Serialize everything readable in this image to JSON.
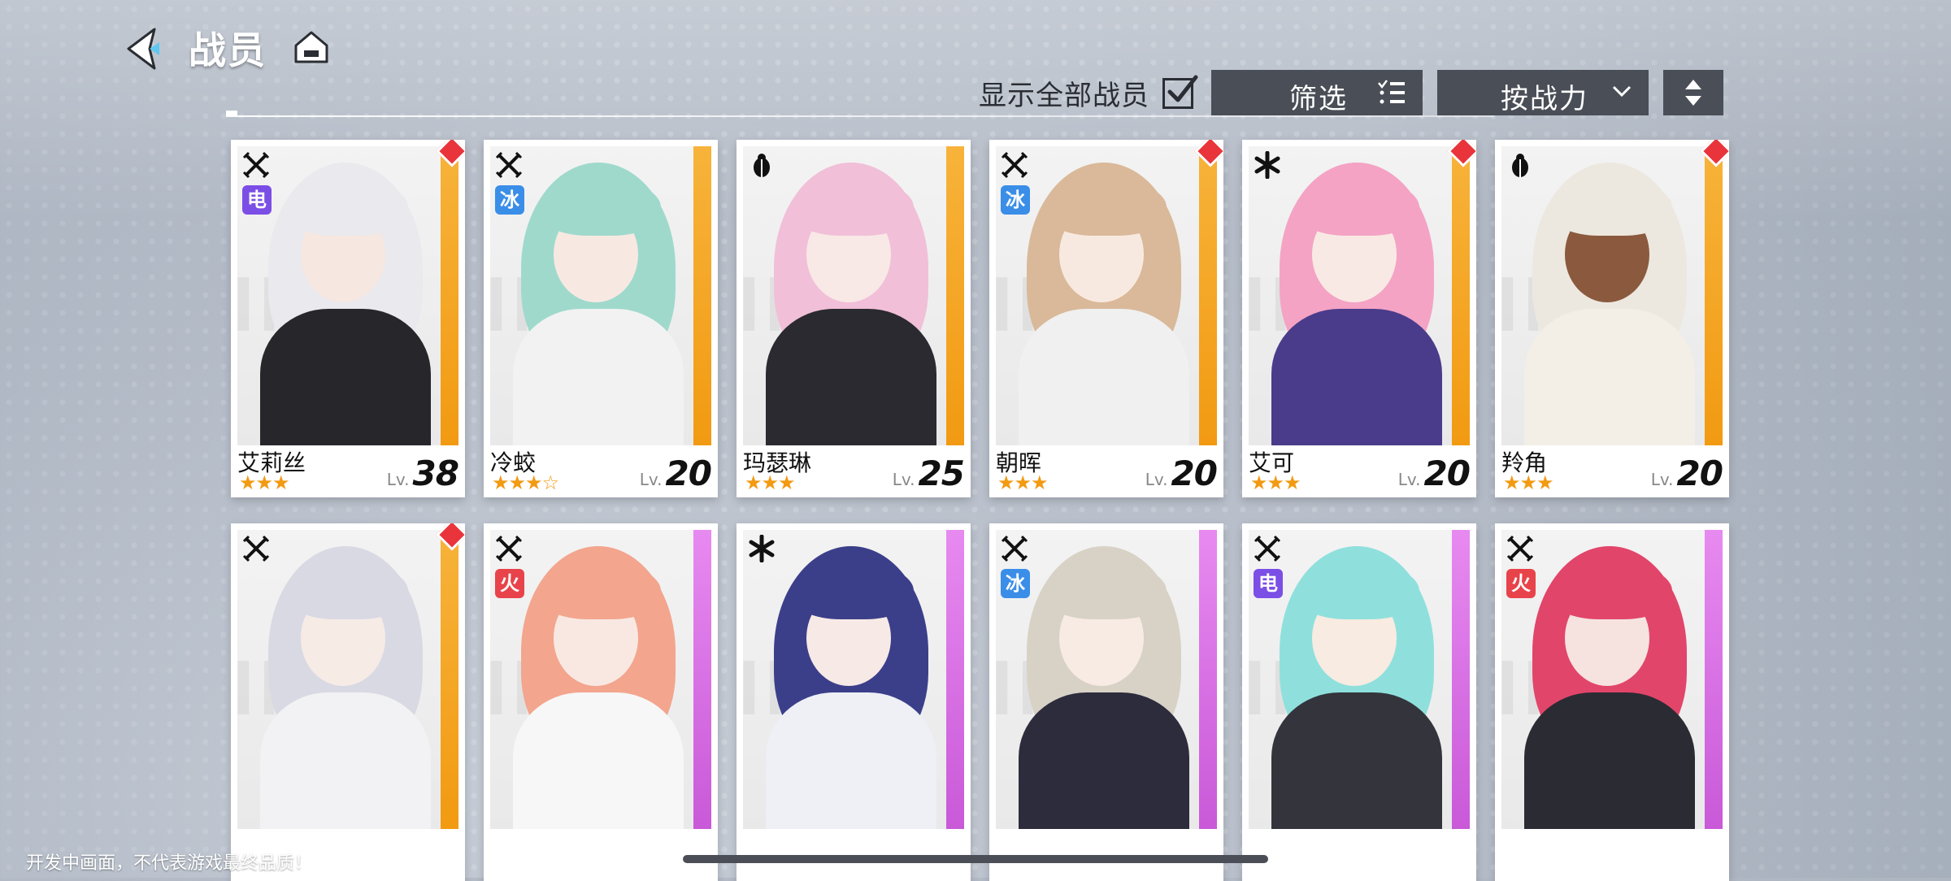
{
  "header": {
    "title": "战员",
    "back_icon": "back-arrow-icon",
    "home_icon": "home-icon"
  },
  "controls": {
    "show_all_label": "显示全部战员",
    "show_all_checked": true,
    "filter_label": "筛选",
    "sort_label": "按战力",
    "order_icon": "sort-order-icon"
  },
  "cards": [
    {
      "name": "艾莉丝",
      "stars": "★★★",
      "lv_prefix": "Lv.",
      "level": "38",
      "element": "电",
      "element_color": "#7b4ee6",
      "class_icon": "crossed-swords-icon",
      "strip": "orange",
      "new_badge": true,
      "palette": {
        "hair": "#e9e9ee",
        "face": "#f6e7e0",
        "body": "#26262b"
      }
    },
    {
      "name": "冷蛟",
      "stars": "★★★☆",
      "lv_prefix": "Lv.",
      "level": "20",
      "element": "冰",
      "element_color": "#3a8ee8",
      "class_icon": "crossed-swords-icon",
      "strip": "orange",
      "new_badge": false,
      "palette": {
        "hair": "#9fd9cc",
        "face": "#f7e9e2",
        "body": "#f2f2f2"
      }
    },
    {
      "name": "玛瑟琳",
      "stars": "★★★",
      "lv_prefix": "Lv.",
      "level": "25",
      "element": "",
      "element_color": "",
      "class_icon": "beetle-icon",
      "strip": "orange",
      "new_badge": false,
      "palette": {
        "hair": "#f1bfd8",
        "face": "#f8e8e6",
        "body": "#2a2a30"
      }
    },
    {
      "name": "朝晖",
      "stars": "★★★",
      "lv_prefix": "Lv.",
      "level": "20",
      "element": "冰",
      "element_color": "#3a8ee8",
      "class_icon": "crossed-swords-icon",
      "strip": "orange",
      "new_badge": true,
      "palette": {
        "hair": "#d9b99a",
        "face": "#f8e9e0",
        "body": "#f0f0f0"
      }
    },
    {
      "name": "艾可",
      "stars": "★★★",
      "lv_prefix": "Lv.",
      "level": "20",
      "element": "",
      "element_color": "",
      "class_icon": "asterisk-icon",
      "strip": "orange",
      "new_badge": true,
      "palette": {
        "hair": "#f4a3c4",
        "face": "#f9e9e4",
        "body": "#4a3c8a"
      }
    },
    {
      "name": "羚角",
      "stars": "★★★",
      "lv_prefix": "Lv.",
      "level": "20",
      "element": "",
      "element_color": "",
      "class_icon": "beetle-icon",
      "strip": "orange",
      "new_badge": true,
      "palette": {
        "hair": "#ece8e0",
        "face": "#8b5a3e",
        "body": "#f3efe6"
      }
    },
    {
      "name": "",
      "stars": "",
      "lv_prefix": "",
      "level": "",
      "element": "",
      "element_color": "",
      "class_icon": "crossed-swords-icon",
      "strip": "orange",
      "new_badge": true,
      "palette": {
        "hair": "#d9d9e4",
        "face": "#f7ebe6",
        "body": "#f2f2f4"
      }
    },
    {
      "name": "",
      "stars": "",
      "lv_prefix": "",
      "level": "",
      "element": "火",
      "element_color": "#e8434a",
      "class_icon": "crossed-swords-icon",
      "strip": "purple",
      "new_badge": false,
      "palette": {
        "hair": "#f3a58e",
        "face": "#f9e8e2",
        "body": "#f7f7f7"
      }
    },
    {
      "name": "",
      "stars": "",
      "lv_prefix": "",
      "level": "",
      "element": "",
      "element_color": "",
      "class_icon": "asterisk-icon",
      "strip": "purple",
      "new_badge": false,
      "palette": {
        "hair": "#3b3f8a",
        "face": "#f7e9e6",
        "body": "#eef0f6"
      }
    },
    {
      "name": "",
      "stars": "",
      "lv_prefix": "",
      "level": "",
      "element": "冰",
      "element_color": "#3a8ee8",
      "class_icon": "crossed-swords-icon",
      "strip": "purple",
      "new_badge": false,
      "palette": {
        "hair": "#d8d2c6",
        "face": "#f8ebe4",
        "body": "#2c2c3c"
      }
    },
    {
      "name": "",
      "stars": "",
      "lv_prefix": "",
      "level": "",
      "element": "电",
      "element_color": "#7b4ee6",
      "class_icon": "crossed-swords-icon",
      "strip": "purple",
      "new_badge": false,
      "palette": {
        "hair": "#8fe0dc",
        "face": "#f8ebe2",
        "body": "#34343c"
      }
    },
    {
      "name": "",
      "stars": "",
      "lv_prefix": "",
      "level": "",
      "element": "火",
      "element_color": "#e8434a",
      "class_icon": "crossed-swords-icon",
      "strip": "purple",
      "new_badge": false,
      "palette": {
        "hair": "#e2456a",
        "face": "#f6e3e0",
        "body": "#2b2b33"
      }
    }
  ],
  "footer": {
    "disclaimer": "开发中画面，不代表游戏最终品质！"
  }
}
